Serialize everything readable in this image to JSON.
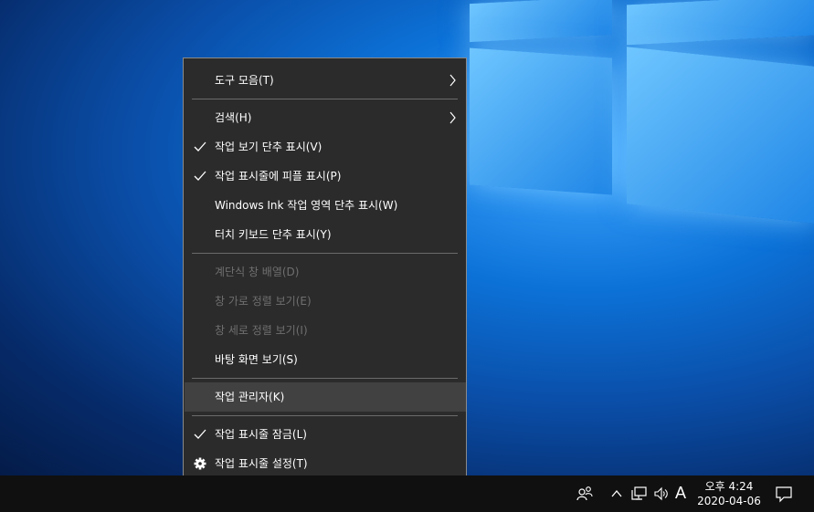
{
  "menu": {
    "items": [
      {
        "label": "도구 모음(T)",
        "checked": false,
        "submenu": true,
        "disabled": false
      },
      {
        "label": "검색(H)",
        "checked": false,
        "submenu": true,
        "disabled": false
      },
      {
        "label": "작업 보기 단추 표시(V)",
        "checked": true,
        "submenu": false,
        "disabled": false
      },
      {
        "label": "작업 표시줄에 피플 표시(P)",
        "checked": true,
        "submenu": false,
        "disabled": false
      },
      {
        "label": "Windows Ink 작업 영역 단추 표시(W)",
        "checked": false,
        "submenu": false,
        "disabled": false
      },
      {
        "label": "터치 키보드 단추 표시(Y)",
        "checked": false,
        "submenu": false,
        "disabled": false
      },
      {
        "label": "계단식 창 배열(D)",
        "checked": false,
        "submenu": false,
        "disabled": true
      },
      {
        "label": "창 가로 정렬 보기(E)",
        "checked": false,
        "submenu": false,
        "disabled": true
      },
      {
        "label": "창 세로 정렬 보기(I)",
        "checked": false,
        "submenu": false,
        "disabled": true
      },
      {
        "label": "바탕 화면 보기(S)",
        "checked": false,
        "submenu": false,
        "disabled": false
      },
      {
        "label": "작업 관리자(K)",
        "checked": false,
        "submenu": false,
        "disabled": false,
        "highlighted": true
      },
      {
        "label": "작업 표시줄 잠금(L)",
        "checked": true,
        "submenu": false,
        "disabled": false
      },
      {
        "label": "작업 표시줄 설정(T)",
        "checked": false,
        "submenu": false,
        "disabled": false,
        "icon": "gear-icon"
      }
    ]
  },
  "taskbar": {
    "people_icon": "people-icon",
    "tray_chevron_icon": "chevron-up-icon",
    "network_icon": "network-icon",
    "volume_icon": "volume-icon",
    "ime_label": "A",
    "clock_time": "오후 4:24",
    "clock_date": "2020-04-06",
    "notification_icon": "action-center-icon"
  },
  "colors": {
    "menu_bg": "#2b2b2b",
    "menu_hover": "#414141",
    "menu_text": "#ffffff",
    "menu_disabled": "#6f6f6f",
    "taskbar_bg": "#101010"
  }
}
